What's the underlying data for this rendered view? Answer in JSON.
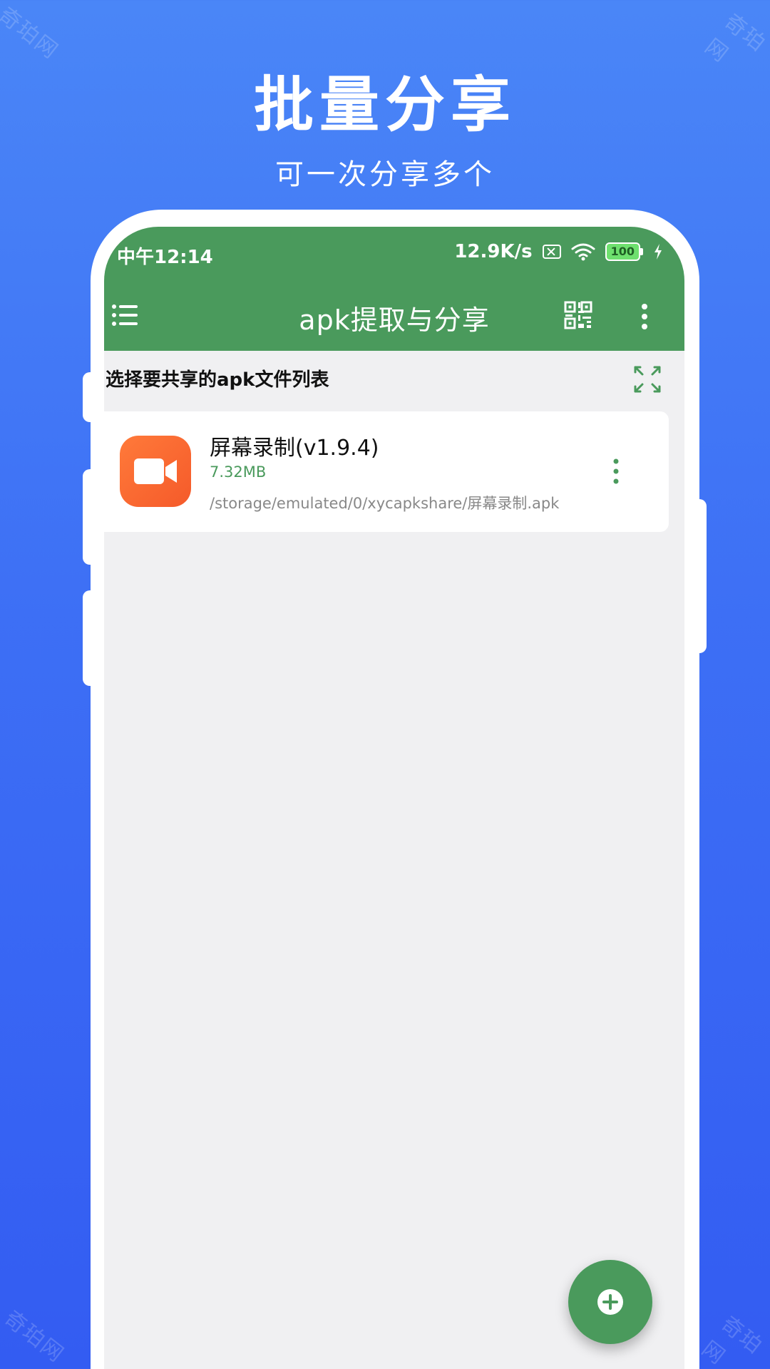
{
  "promo": {
    "title": "批量分享",
    "subtitle": "可一次分享多个"
  },
  "watermark": "奇珀网",
  "status_bar": {
    "time": "中午12:14",
    "network_speed": "12.9K/s",
    "battery": "100",
    "icons": [
      "sim-x-icon",
      "wifi-icon",
      "battery-icon",
      "charging-icon"
    ]
  },
  "toolbar": {
    "title": "apk提取与分享",
    "icons": [
      "menu-list-icon",
      "qr-code-icon",
      "more-vert-icon"
    ]
  },
  "section": {
    "title": "选择要共享的apk文件列表",
    "icon": "expand-icon"
  },
  "apps": [
    {
      "name": "屏幕录制(v1.9.4)",
      "size": "7.32MB",
      "path": "/storage/emulated/0/xycapkshare/屏幕录制.apk",
      "icon": "video-camera-icon"
    }
  ],
  "fab": {
    "icon": "add-circle-icon"
  },
  "colors": {
    "background_top": "#4a86f7",
    "background_bottom": "#335cf2",
    "app_bar": "#4a9a5c",
    "accent_green": "#4a9a5c",
    "app_icon_orange": "#f55a2a",
    "screen_bg": "#f0f0f2"
  }
}
